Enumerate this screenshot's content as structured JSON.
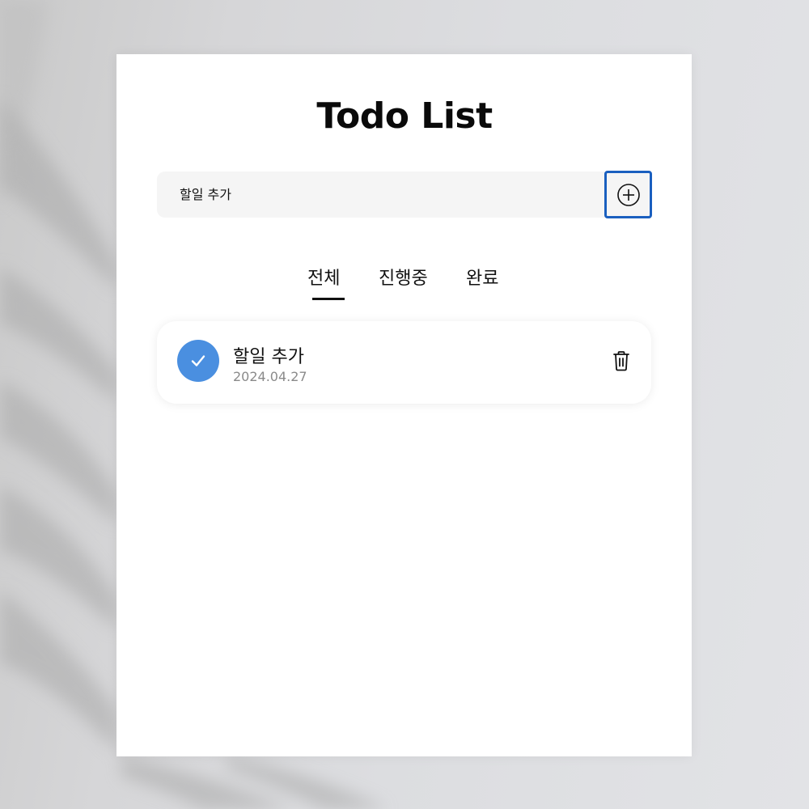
{
  "app": {
    "title": "Todo List"
  },
  "add_form": {
    "input_placeholder": "할일 추가",
    "add_icon": "plus-circle-icon"
  },
  "tabs": [
    {
      "label": "전체",
      "active": true
    },
    {
      "label": "진행중",
      "active": false
    },
    {
      "label": "완료",
      "active": false
    }
  ],
  "todos": [
    {
      "text": "할일 추가",
      "date": "2024.04.27",
      "done": true,
      "check_icon": "check-icon",
      "delete_icon": "trash-icon"
    }
  ],
  "colors": {
    "accent": "#4a8fe0",
    "button_border": "#1a5fbf",
    "input_bg": "#f5f5f5",
    "date_text": "#8a8a8a"
  }
}
